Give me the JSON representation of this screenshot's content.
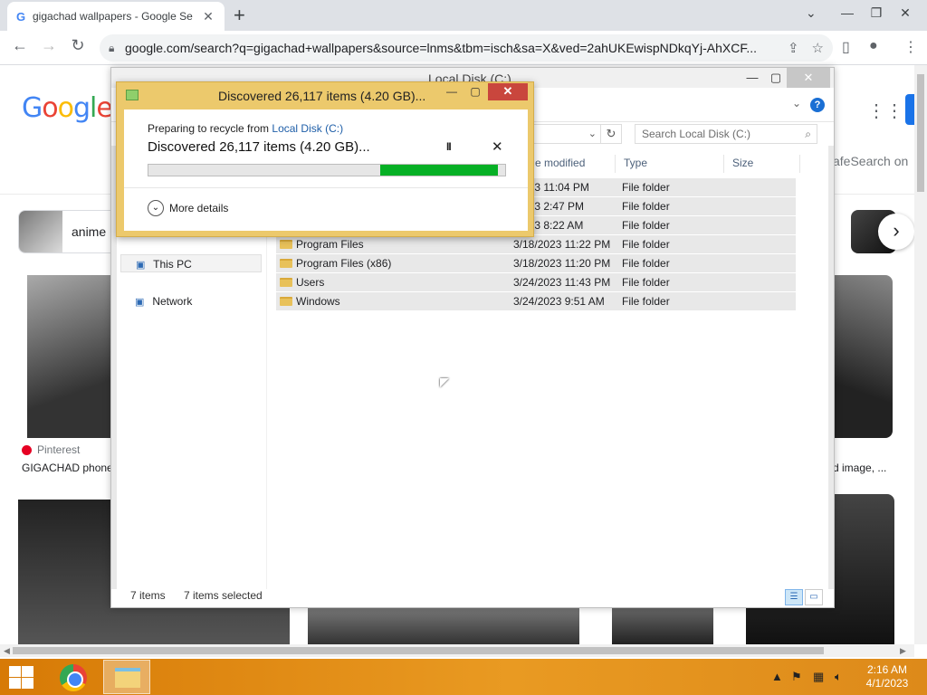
{
  "browser": {
    "tab_title": "gigachad wallpapers - Google Se",
    "tab_favicon": "G",
    "url": "google.com/search?q=gigachad+wallpapers&source=lnms&tbm=isch&sa=X&ved=2ahUKEwispNDkqYj-AhXCF..."
  },
  "google": {
    "logo_letters": [
      "G",
      "o",
      "o",
      "g",
      "l",
      "e"
    ],
    "safesearch": "afeSearch on",
    "chip_label": "anime",
    "source_name": "Pinterest",
    "caption_left": "GIGACHAD phone",
    "caption_right": "d image, ..."
  },
  "explorer": {
    "title": "Local Disk (C:)",
    "search_placeholder": "Search Local Disk (C:)",
    "columns": {
      "modified": "e modified",
      "type": "Type",
      "size": "Size"
    },
    "nav": [
      {
        "label": "This PC",
        "icon": "computer-icon"
      },
      {
        "label": "Network",
        "icon": "network-icon"
      }
    ],
    "rows": [
      {
        "name": "",
        "modified": "/2023 11:04 PM",
        "type": "File folder"
      },
      {
        "name": "",
        "modified": "/2023 2:47 PM",
        "type": "File folder"
      },
      {
        "name": "",
        "modified": "/2013 8:22 AM",
        "type": "File folder"
      },
      {
        "name": "Program Files",
        "modified": "3/18/2023 11:22 PM",
        "type": "File folder"
      },
      {
        "name": "Program Files (x86)",
        "modified": "3/18/2023 11:20 PM",
        "type": "File folder"
      },
      {
        "name": "Users",
        "modified": "3/24/2023 11:43 PM",
        "type": "File folder"
      },
      {
        "name": "Windows",
        "modified": "3/24/2023 9:51 AM",
        "type": "File folder"
      }
    ],
    "status_items": "7 items",
    "status_selected": "7 items selected"
  },
  "dialog": {
    "title": "Discovered 26,117 items (4.20 GB)...",
    "preparing_prefix": "Preparing to recycle from",
    "preparing_link": "Local Disk (C:)",
    "main_text": "Discovered 26,117 items (4.20 GB)...",
    "pause_glyph": "II",
    "cancel_glyph": "✕",
    "more_details": "More details",
    "progress": {
      "fill_start": 0.65,
      "fill_end": 0.98
    }
  },
  "taskbar": {
    "time": "2:16 AM",
    "date": "4/1/2023"
  },
  "colors": {
    "dialog_frame": "#ecc96c",
    "progress_green": "#06b025",
    "taskbar": "#e99a22",
    "link_blue": "#1e5ea8"
  }
}
